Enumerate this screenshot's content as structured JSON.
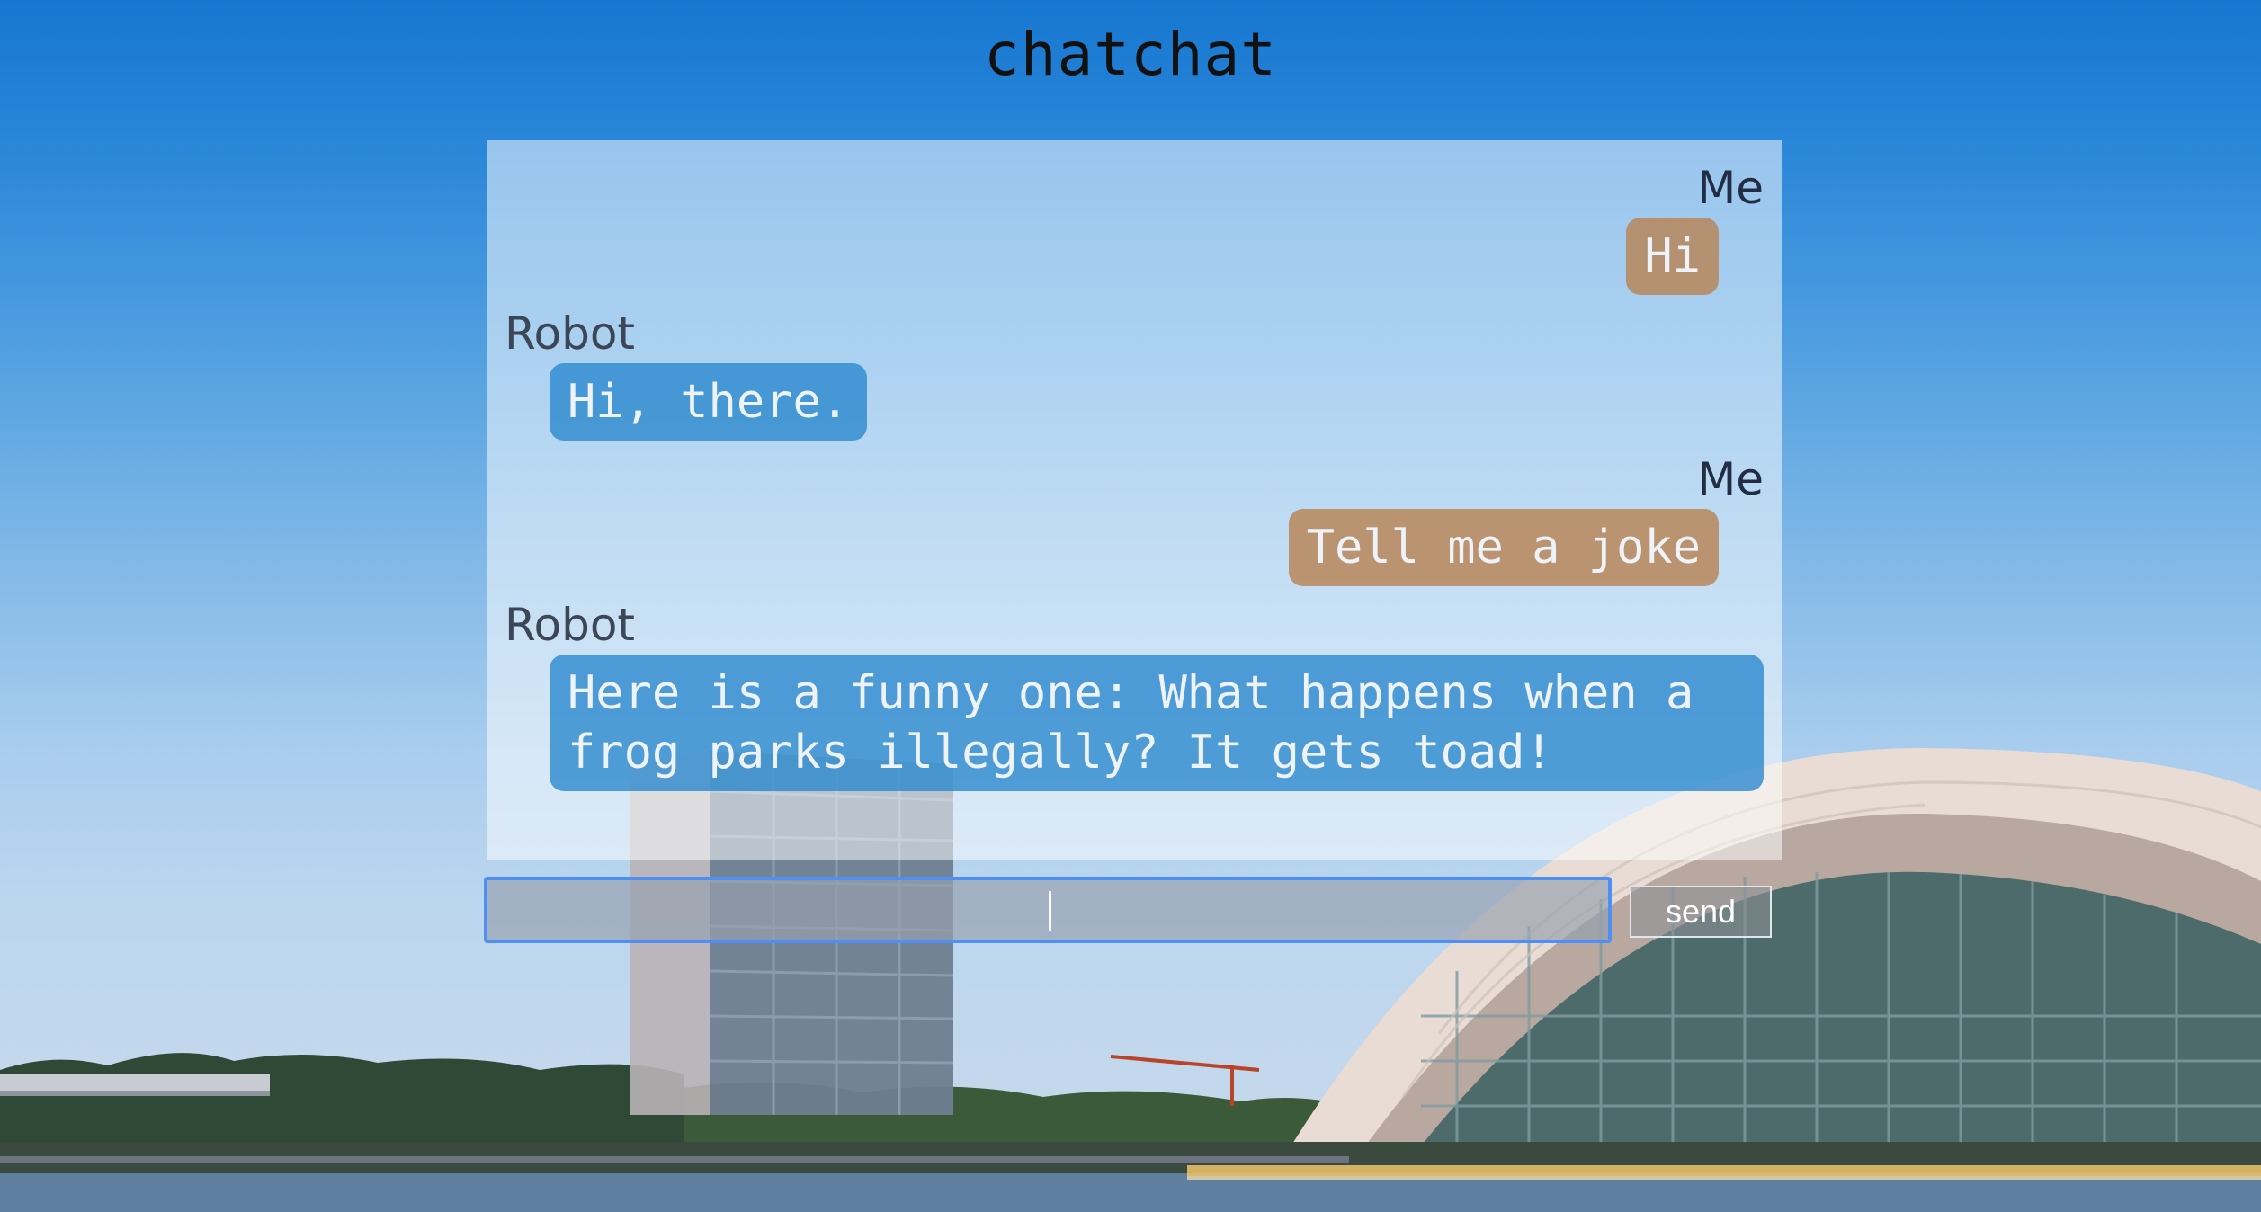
{
  "app": {
    "title": "chatchat"
  },
  "messages": [
    {
      "sender": "Me",
      "role": "me",
      "text": "Hi"
    },
    {
      "sender": "Robot",
      "role": "robot",
      "text": "Hi, there."
    },
    {
      "sender": "Me",
      "role": "me",
      "text": "Tell me a joke"
    },
    {
      "sender": "Robot",
      "role": "robot",
      "text": "Here is a funny one: What happens when a frog parks illegally? It gets toad!"
    }
  ],
  "composer": {
    "value": "",
    "send_label": "send"
  },
  "colors": {
    "me_bubble": "#b88454",
    "robot_bubble": "#2887cd",
    "input_focus_border": "#4d8ff5"
  }
}
